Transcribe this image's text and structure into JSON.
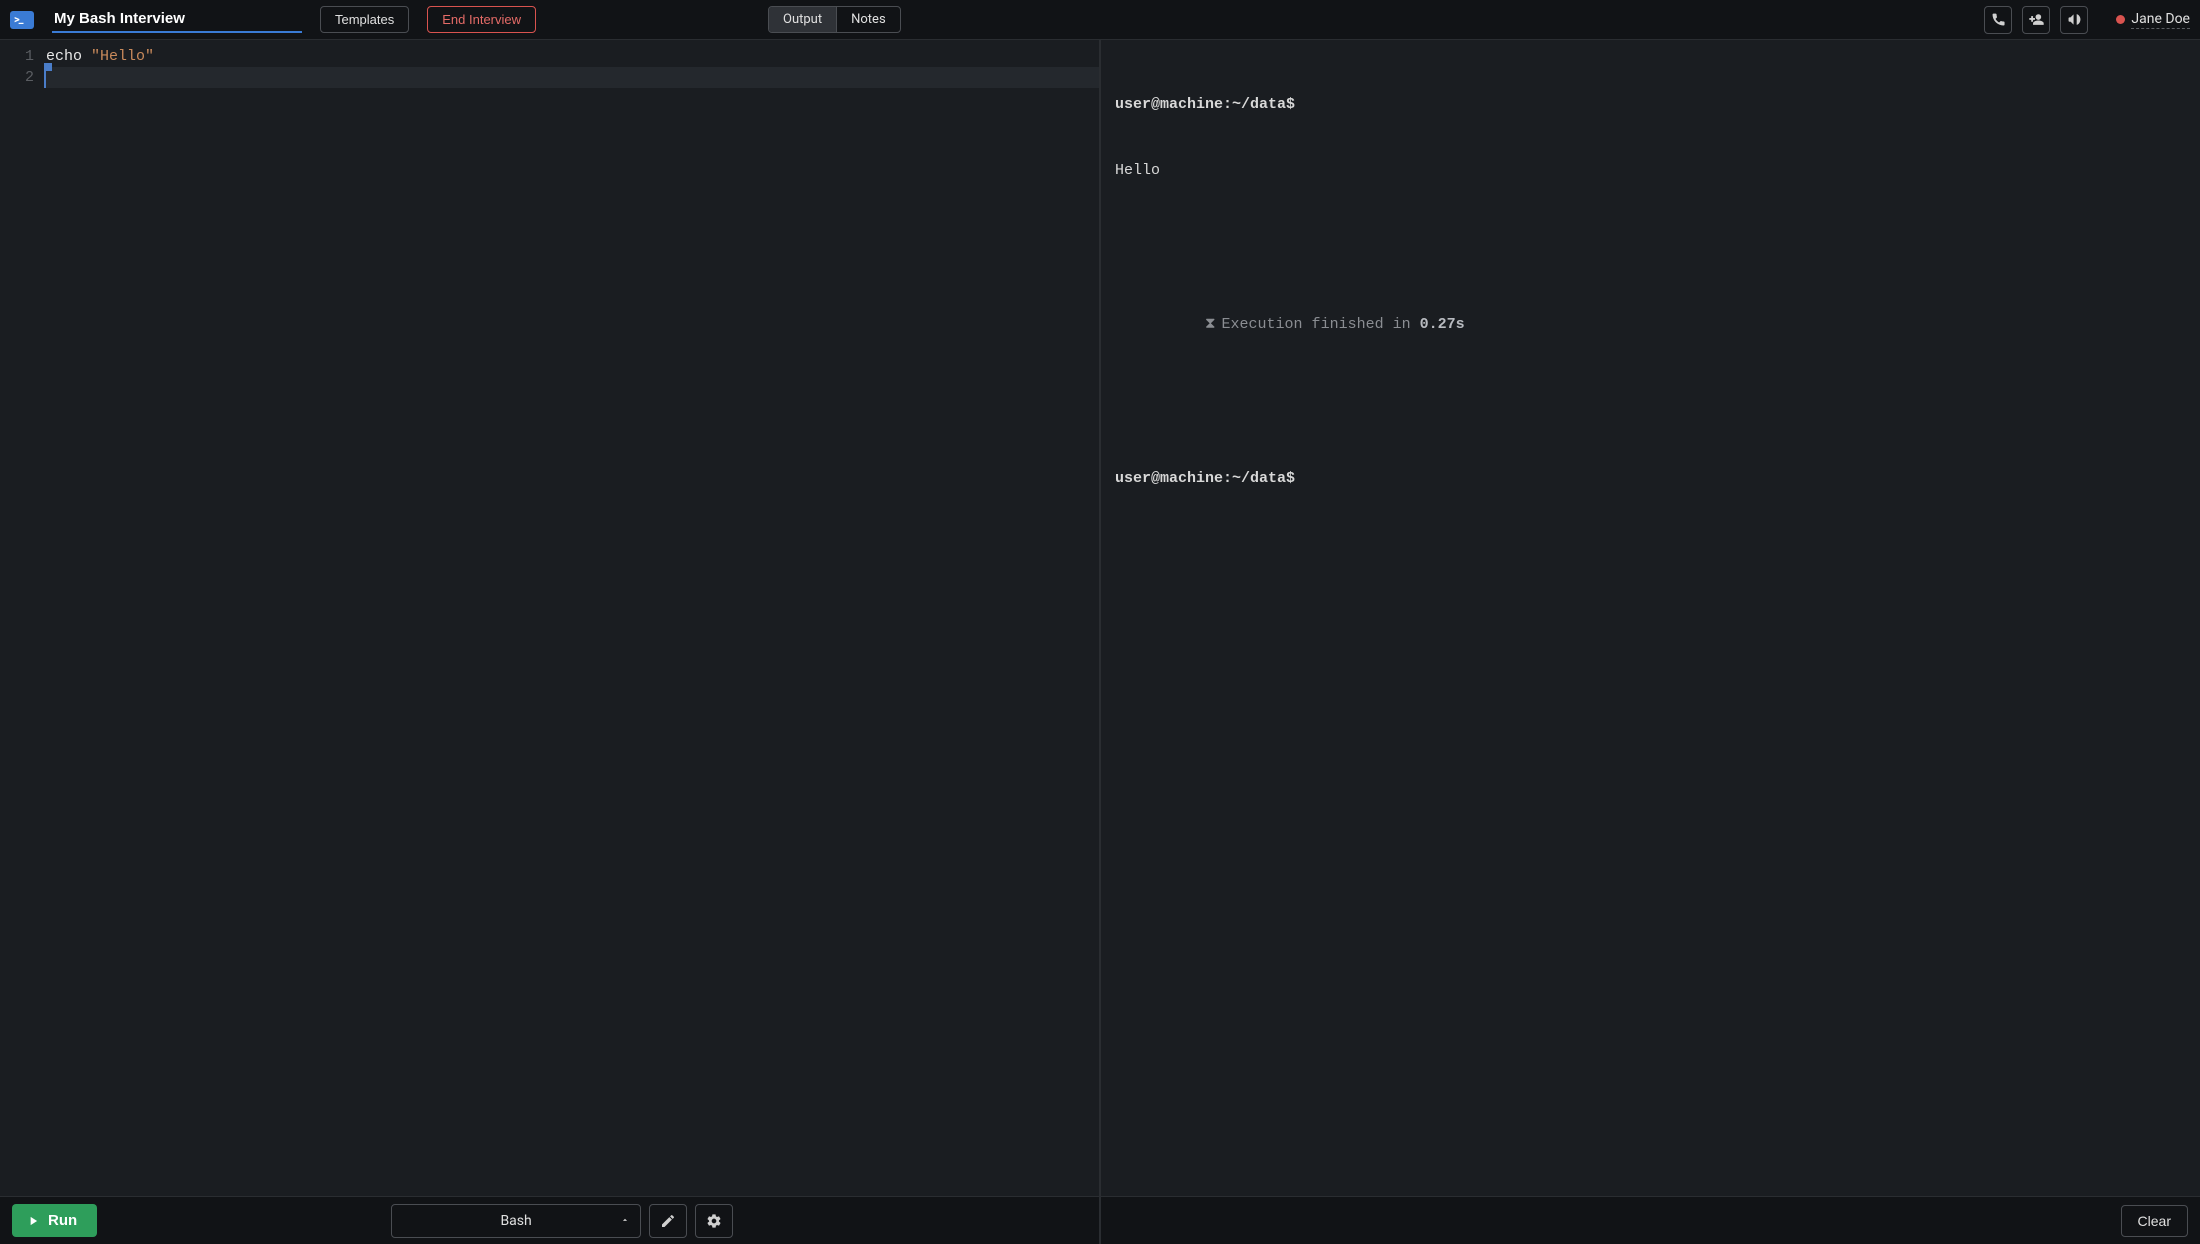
{
  "header": {
    "title": "My Bash Interview",
    "templates_label": "Templates",
    "end_interview_label": "End Interview"
  },
  "tabs": {
    "output": "Output",
    "notes": "Notes",
    "active": "output"
  },
  "presence": {
    "name": "Jane Doe",
    "status_color": "#d9534f"
  },
  "icons": {
    "phone": "phone-icon",
    "invite": "add-person-icon",
    "announce": "megaphone-icon"
  },
  "editor": {
    "lines": [
      {
        "n": "1",
        "tokens": [
          {
            "cls": "tok-cmd",
            "t": "echo"
          },
          {
            "cls": "",
            "t": " "
          },
          {
            "cls": "tok-str",
            "t": "\"Hello\""
          }
        ],
        "active": false,
        "cursor": false
      },
      {
        "n": "2",
        "tokens": [],
        "active": true,
        "cursor": true
      }
    ]
  },
  "terminal": {
    "prompt": "user@machine:~/data$",
    "output": "Hello",
    "exec_prefix": "Execution finished in ",
    "exec_time": "0.27s",
    "prompt2": "user@machine:~/data$"
  },
  "bottom": {
    "run_label": "Run",
    "language": "Bash",
    "clear_label": "Clear"
  }
}
